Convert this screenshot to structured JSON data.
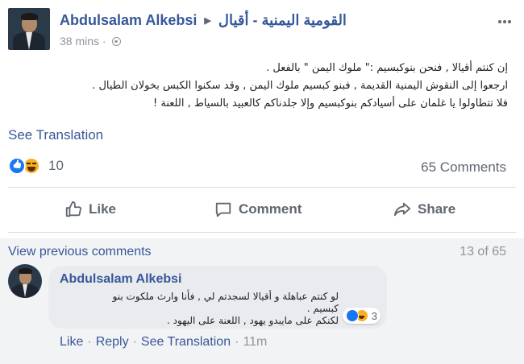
{
  "post": {
    "author": "Abdulsalam Alkebsi",
    "group": "القومية اليمنية - أقيال",
    "time": "38 mins",
    "body": [
      "إن كنتم أقيالا , فنحن بنوكبسيم :\" ملوك اليمن \" بالفعل .",
      "ارجعوا إلى النقوش اليمنية القديمة , فبنو كبسيم ملوك اليمن , وقد سكنوا الكبس بخولان الطيال .",
      "فلا تتطاولوا يا غلمان على أسيادكم بنوكبسيم وإلا جلدناكم كالعبيد بالسياط , اللعنة !"
    ],
    "see_translation": "See Translation",
    "reaction_count": "10",
    "comments_count": "65 Comments"
  },
  "actions": {
    "like": "Like",
    "comment": "Comment",
    "share": "Share"
  },
  "comments": {
    "view_previous": "View previous comments",
    "page_count": "13 of 65",
    "item": {
      "author": "Abdulsalam Alkebsi",
      "text": [
        "لو كنتم عباهلة و أقيالا لسجدتم لي , فأنا وارث ملكوت بنو كبسيم .",
        "لكنكم على مايبدو يهود , اللعنة على اليهود ."
      ],
      "reaction_count": "3",
      "like": "Like",
      "reply": "Reply",
      "see_translation": "See Translation",
      "time": "11m"
    }
  },
  "colors": {
    "link": "#385898",
    "author": "#365899",
    "muted": "#90949c",
    "like_blue": "#1877f2",
    "haha_yellow": "#f7b125"
  }
}
